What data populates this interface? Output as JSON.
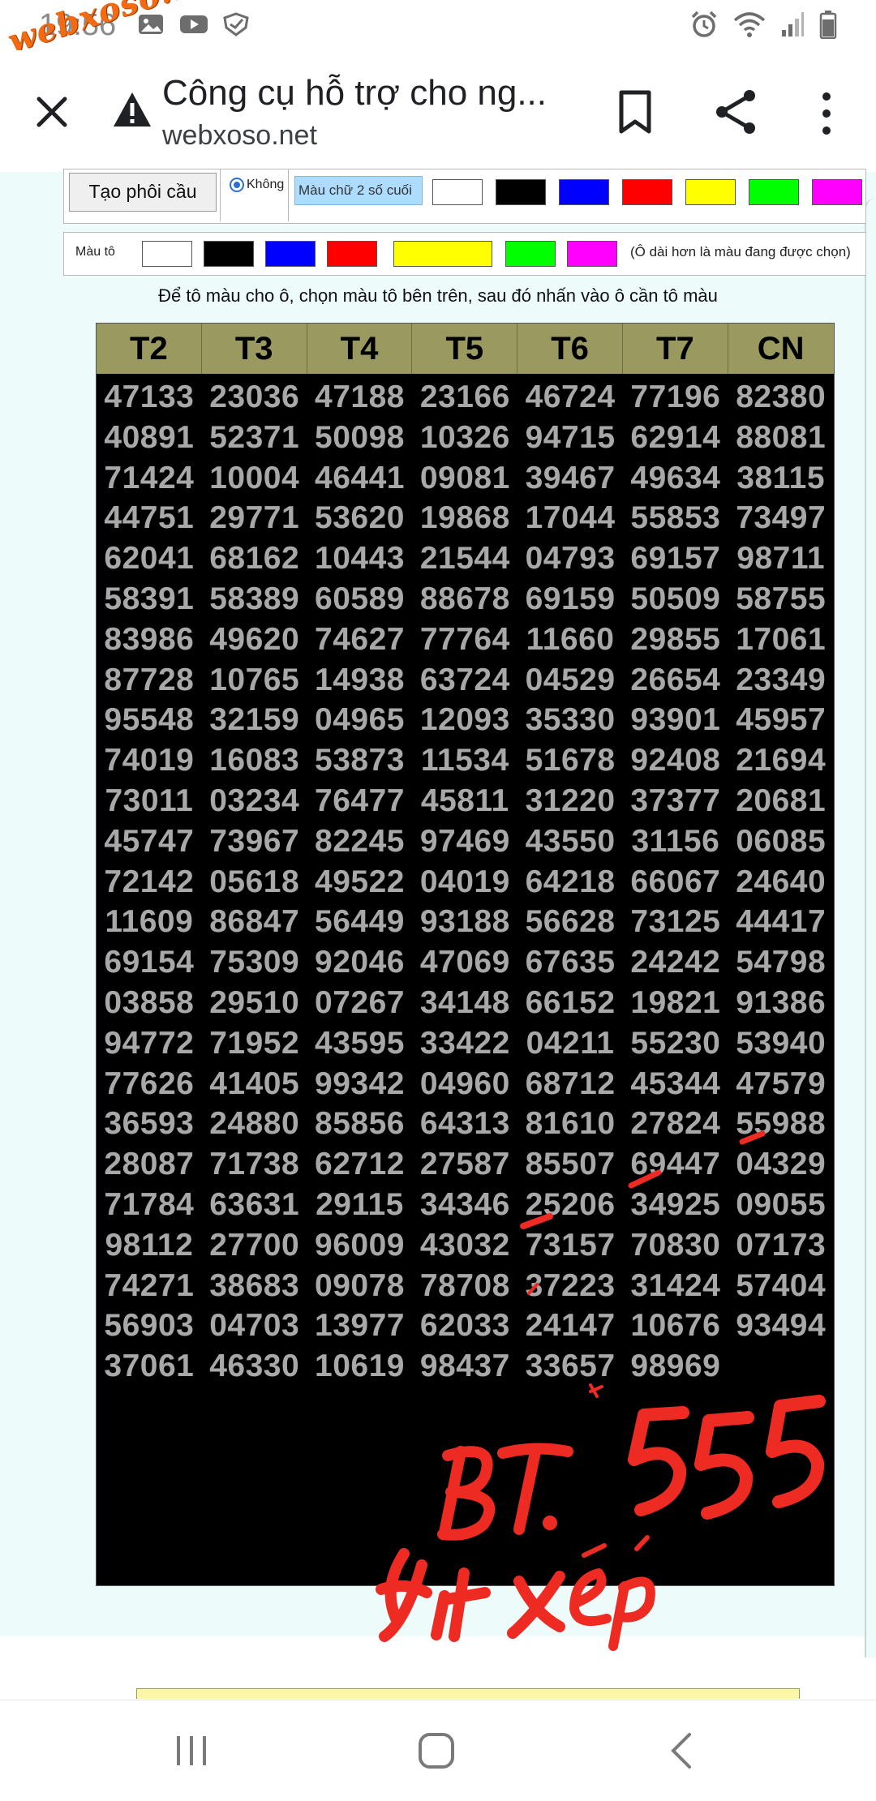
{
  "status_bar": {
    "time": "19:56",
    "left_icons": [
      "gallery-icon",
      "youtube-icon",
      "shield-icon"
    ],
    "right_icons": [
      "alarm-icon",
      "wifi-icon",
      "signal-icon",
      "battery-icon"
    ]
  },
  "watermark": {
    "text": "webxoso.net"
  },
  "toolbar": {
    "title": "Công cụ hỗ trợ cho ng...",
    "url": "webxoso.net",
    "icons": [
      "close-icon",
      "warning-icon",
      "bookmark-icon",
      "share-icon",
      "more-icon"
    ]
  },
  "controls": {
    "create_button": "Tạo phôi cầu",
    "radio_label": "Không",
    "last2_label": "Màu chữ 2 số cuối",
    "last2_colors": [
      "#ffffff",
      "#000000",
      "#0000ff",
      "#ff0000",
      "#ffff00",
      "#00ff00",
      "#ff00ff"
    ],
    "paint_label": "Màu tô",
    "paint_colors": [
      "#ffffff",
      "#000000",
      "#0000ff",
      "#ff0000",
      "#ffff00",
      "#00ff00",
      "#ff00ff"
    ],
    "paint_note": "(Ô dài hơn là màu đang được chọn)",
    "instruction": "Để tô màu cho ô, chọn màu tô bên trên, sau đó nhấn vào ô cần tô màu"
  },
  "table": {
    "headers": [
      "T2",
      "T3",
      "T4",
      "T5",
      "T6",
      "T7",
      "CN"
    ],
    "rows": [
      [
        "47133",
        "23036",
        "47188",
        "23166",
        "46724",
        "77196",
        "82380"
      ],
      [
        "40891",
        "52371",
        "50098",
        "10326",
        "94715",
        "62914",
        "88081"
      ],
      [
        "71424",
        "10004",
        "46441",
        "09081",
        "39467",
        "49634",
        "38115"
      ],
      [
        "44751",
        "29771",
        "53620",
        "19868",
        "17044",
        "55853",
        "73497"
      ],
      [
        "62041",
        "68162",
        "10443",
        "21544",
        "04793",
        "69157",
        "98711"
      ],
      [
        "58391",
        "58389",
        "60589",
        "88678",
        "69159",
        "50509",
        "58755"
      ],
      [
        "83986",
        "49620",
        "74627",
        "77764",
        "11660",
        "29855",
        "17061"
      ],
      [
        "87728",
        "10765",
        "14938",
        "63724",
        "04529",
        "26654",
        "23349"
      ],
      [
        "95548",
        "32159",
        "04965",
        "12093",
        "35330",
        "93901",
        "45957"
      ],
      [
        "74019",
        "16083",
        "53873",
        "11534",
        "51678",
        "92408",
        "21694"
      ],
      [
        "73011",
        "03234",
        "76477",
        "45811",
        "31220",
        "37377",
        "20681"
      ],
      [
        "45747",
        "73967",
        "82245",
        "97469",
        "43550",
        "31156",
        "06085"
      ],
      [
        "72142",
        "05618",
        "49522",
        "04019",
        "64218",
        "66067",
        "24640"
      ],
      [
        "11609",
        "86847",
        "56449",
        "93188",
        "56628",
        "73125",
        "44417"
      ],
      [
        "69154",
        "75309",
        "92046",
        "47069",
        "67635",
        "24242",
        "54798"
      ],
      [
        "03858",
        "29510",
        "07267",
        "34148",
        "66152",
        "19821",
        "91386"
      ],
      [
        "94772",
        "71952",
        "43595",
        "33422",
        "04211",
        "55230",
        "53940"
      ],
      [
        "77626",
        "41405",
        "99342",
        "04960",
        "68712",
        "45344",
        "47579"
      ],
      [
        "36593",
        "24880",
        "85856",
        "64313",
        "81610",
        "27824",
        "55988"
      ],
      [
        "28087",
        "71738",
        "62712",
        "27587",
        "85507",
        "69447",
        "04329"
      ],
      [
        "71784",
        "63631",
        "29115",
        "34346",
        "25206",
        "34925",
        "09055"
      ],
      [
        "98112",
        "27700",
        "96009",
        "43032",
        "73157",
        "70830",
        "07173"
      ],
      [
        "74271",
        "38683",
        "09078",
        "78708",
        "37223",
        "31424",
        "57404"
      ],
      [
        "56903",
        "04703",
        "13977",
        "62033",
        "24147",
        "10676",
        "93494"
      ],
      [
        "37061",
        "46330",
        "10619",
        "98437",
        "33657",
        "98969",
        ""
      ]
    ]
  },
  "annotation": {
    "line1_left": "BT.",
    "line1_right": "555",
    "line2": "Xít Xếp",
    "color": "#ee2b22"
  },
  "nav": {
    "icons": [
      "recents-icon",
      "home-icon",
      "back-icon"
    ]
  }
}
